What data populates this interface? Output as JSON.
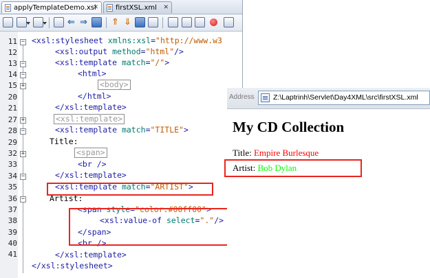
{
  "editor": {
    "tabs": [
      {
        "label": "applyTemplateDemo.xsl",
        "close": "✕"
      },
      {
        "label": "firstXSL.xml",
        "close": "✕"
      }
    ],
    "line_numbers": [
      "11",
      "12",
      "13",
      "14",
      "15",
      "20",
      "21",
      "27",
      "28",
      "29",
      "32",
      "33",
      "34",
      "35",
      "36",
      "37",
      "38",
      "39",
      "40",
      "41"
    ],
    "code": {
      "l11": {
        "open": "<xsl:stylesheet ",
        "attr": "xmlns:xsl",
        "eq": "=",
        "val": "\"http://www.w3"
      },
      "l12": {
        "open": "<xsl:output ",
        "attr": "method",
        "eq": "=",
        "val": "\"html\"",
        "close": "/>"
      },
      "l13": {
        "open": "<xsl:template ",
        "attr": "match",
        "eq": "=",
        "val": "\"/\"",
        "close": ">"
      },
      "l14": {
        "text": "<html>"
      },
      "l15": {
        "folded": "<body>"
      },
      "l20": {
        "text": "</html>"
      },
      "l21": {
        "text": "</xsl:template>"
      },
      "l27": {
        "folded": "<xsl:template>"
      },
      "l28": {
        "open": "<xsl:template ",
        "attr": "match",
        "eq": "=",
        "val": "\"TITLE\"",
        "close": ">"
      },
      "l29": {
        "text": "Title:"
      },
      "l32": {
        "folded": "<span>"
      },
      "l33": {
        "text": "<br />"
      },
      "l34": {
        "text": "</xsl:template>"
      },
      "l35": {
        "open": "<xsl:template ",
        "attr": "match",
        "eq": "=",
        "val": "\"ARTIST\"",
        "close": ">"
      },
      "l36": {
        "text": "Artist:"
      },
      "l37": {
        "open": "<span ",
        "attr": "style",
        "eq": "=",
        "val": "\"color:#00ff00\"",
        "close": ">"
      },
      "l38": {
        "open": "<xsl:value-of ",
        "attr": "select",
        "eq": "=",
        "val": "\".\"",
        "close": "/>"
      },
      "l39": {
        "text": "</span>"
      },
      "l40": {
        "text": "<br />"
      },
      "l41": {
        "text": "</xsl:template>"
      },
      "l42": {
        "text": "</xsl:stylesheet>"
      }
    }
  },
  "browser": {
    "address_label": "Address",
    "address_value": "Z:\\Laptrinh\\Servlet\\Day4XML\\src\\firstXSL.xml",
    "heading": "My CD Collection",
    "title_label": "Title: ",
    "title_value": "Empire Burlesque",
    "artist_label": "Artist: ",
    "artist_value": "Bob Dylan"
  },
  "colors": {
    "highlight_box": "#e8241e",
    "title_value": "#ff0000",
    "artist_value": "#00ff00"
  },
  "icons": [
    "save-icon",
    "dropdown-icon",
    "find-icon",
    "back-icon",
    "forward-icon",
    "toggle-icon",
    "up-icon",
    "down-icon",
    "run-icon",
    "stop-icon",
    "file-icon",
    "page-icon"
  ]
}
